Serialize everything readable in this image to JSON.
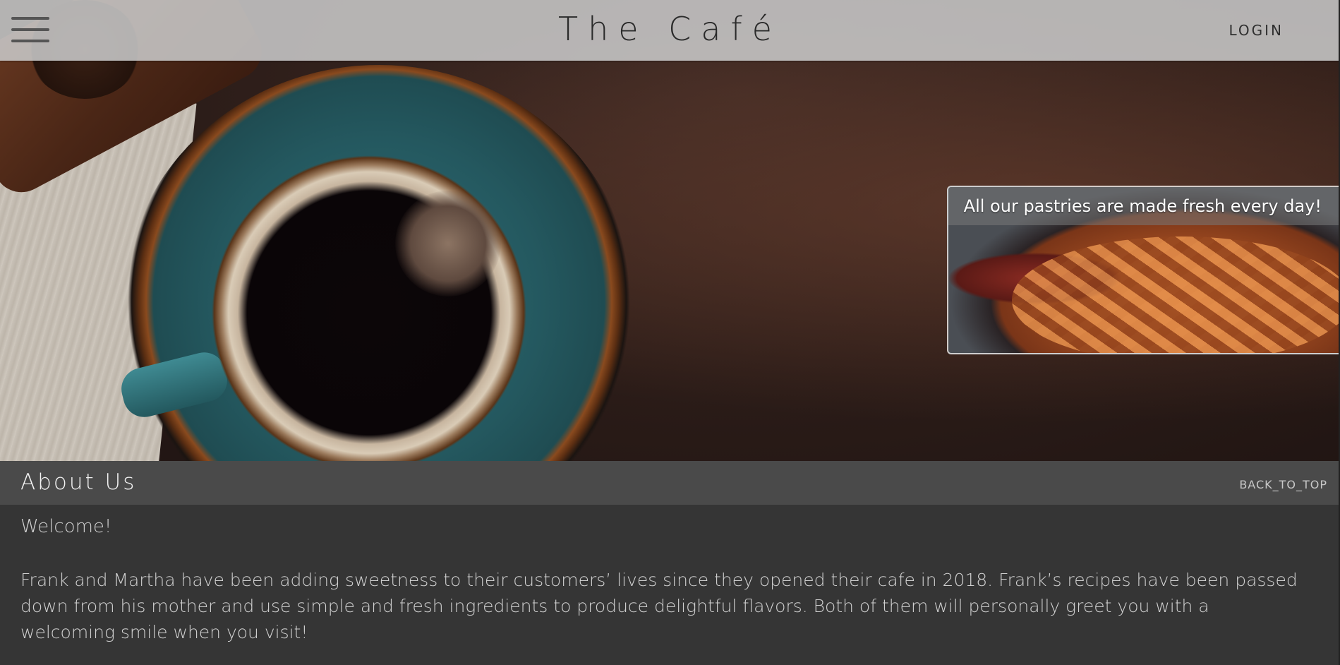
{
  "header": {
    "brand": "The Café",
    "login_label": "LOGIN",
    "menu_icon": "hamburger-menu-icon"
  },
  "hero": {
    "promo": {
      "caption": "All our pastries are made fresh every day!"
    }
  },
  "about": {
    "title": "About Us",
    "back_to_top": "BACK_TO_TOP",
    "welcome": "Welcome!",
    "story": "Frank and Martha have been adding sweetness to their customers’ lives since they opened their cafe in 2018. Frank’s recipes have been passed down from his mother and use simple and fresh ingredients to produce delightful flavors. Both of them will personally greet you with a welcoming smile when you visit!"
  },
  "colors": {
    "header_bg": "#c8c8c8",
    "section_bar": "#4a4a4a",
    "section_body": "#353535",
    "text_light": "#d0d0d0"
  }
}
